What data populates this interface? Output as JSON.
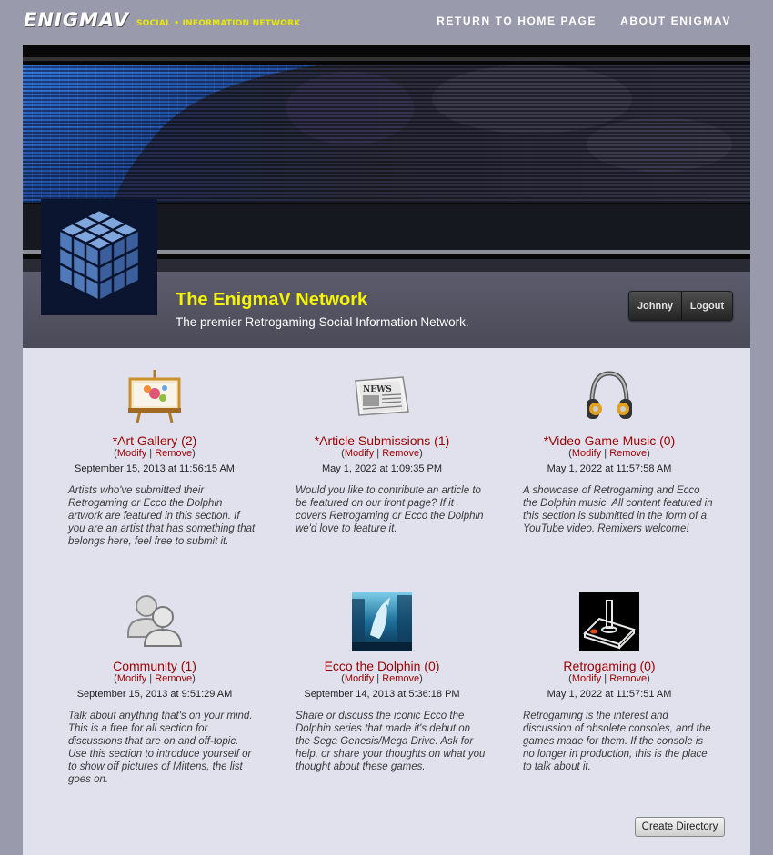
{
  "header": {
    "logo_main": "ENIGMAV",
    "logo_sub": "SOCIAL • INFORMATION NETWORK",
    "nav": [
      {
        "label": "RETURN TO HOME PAGE"
      },
      {
        "label": "ABOUT ENIGMAV"
      }
    ]
  },
  "profile": {
    "title": "The EnigmaV Network",
    "tagline": "The premier Retrogaming Social Information Network.",
    "user_button": "Johnny",
    "logout_button": "Logout"
  },
  "actions": {
    "modify": "Modify",
    "remove": "Remove",
    "separator": "|"
  },
  "directories": [
    {
      "icon": "easel-art-icon",
      "title": "*Art Gallery (2)",
      "date": "September 15, 2013 at 11:56:15 AM",
      "description": "Artists who've submitted their Retrogaming or Ecco the Dolphin artwork are featured in this section. If you are an artist that has something that belongs here, feel free to submit it."
    },
    {
      "icon": "newspaper-icon",
      "title": "*Article Submissions (1)",
      "date": "May 1, 2022 at 1:09:35 PM",
      "description": "Would you like to contribute an article to be featured on our front page? If it covers Retrogaming or Ecco the Dolphin we'd love to feature it."
    },
    {
      "icon": "headphones-icon",
      "title": "*Video Game Music (0)",
      "date": "May 1, 2022 at 11:57:58 AM",
      "description": "A showcase of Retrogaming and Ecco the Dolphin music. All content featured in this section is submitted in the form of a YouTube video. Remixers welcome!"
    },
    {
      "icon": "users-icon",
      "title": "Community (1)",
      "date": "September 15, 2013 at 9:51:29 AM",
      "description": "Talk about anything that's on your mind. This is a free for all section for discussions that are on and off-topic. Use this section to introduce yourself or to show off pictures of Mittens, the list goes on."
    },
    {
      "icon": "dolphin-icon",
      "title": "Ecco the Dolphin (0)",
      "date": "September 14, 2013 at 5:36:18 PM",
      "description": "Share or discuss the iconic Ecco the Dolphin series that made it's debut on the Sega Genesis/Mega Drive. Ask for help, or share your thoughts on what you thought about these games."
    },
    {
      "icon": "joystick-icon",
      "title": "Retrogaming (0)",
      "date": "May 1, 2022 at 11:57:51 AM",
      "description": "Retrogaming is the interest and discussion of obsolete consoles, and the games made for them. If the console is no longer in production, this is the place to talk about it."
    }
  ],
  "create_directory": "Create Directory",
  "colors": {
    "page_bg": "#9a9aad",
    "panel_bg": "#e1e1ee",
    "title_yellow": "#f5f500",
    "link_red": "#9d0000"
  }
}
